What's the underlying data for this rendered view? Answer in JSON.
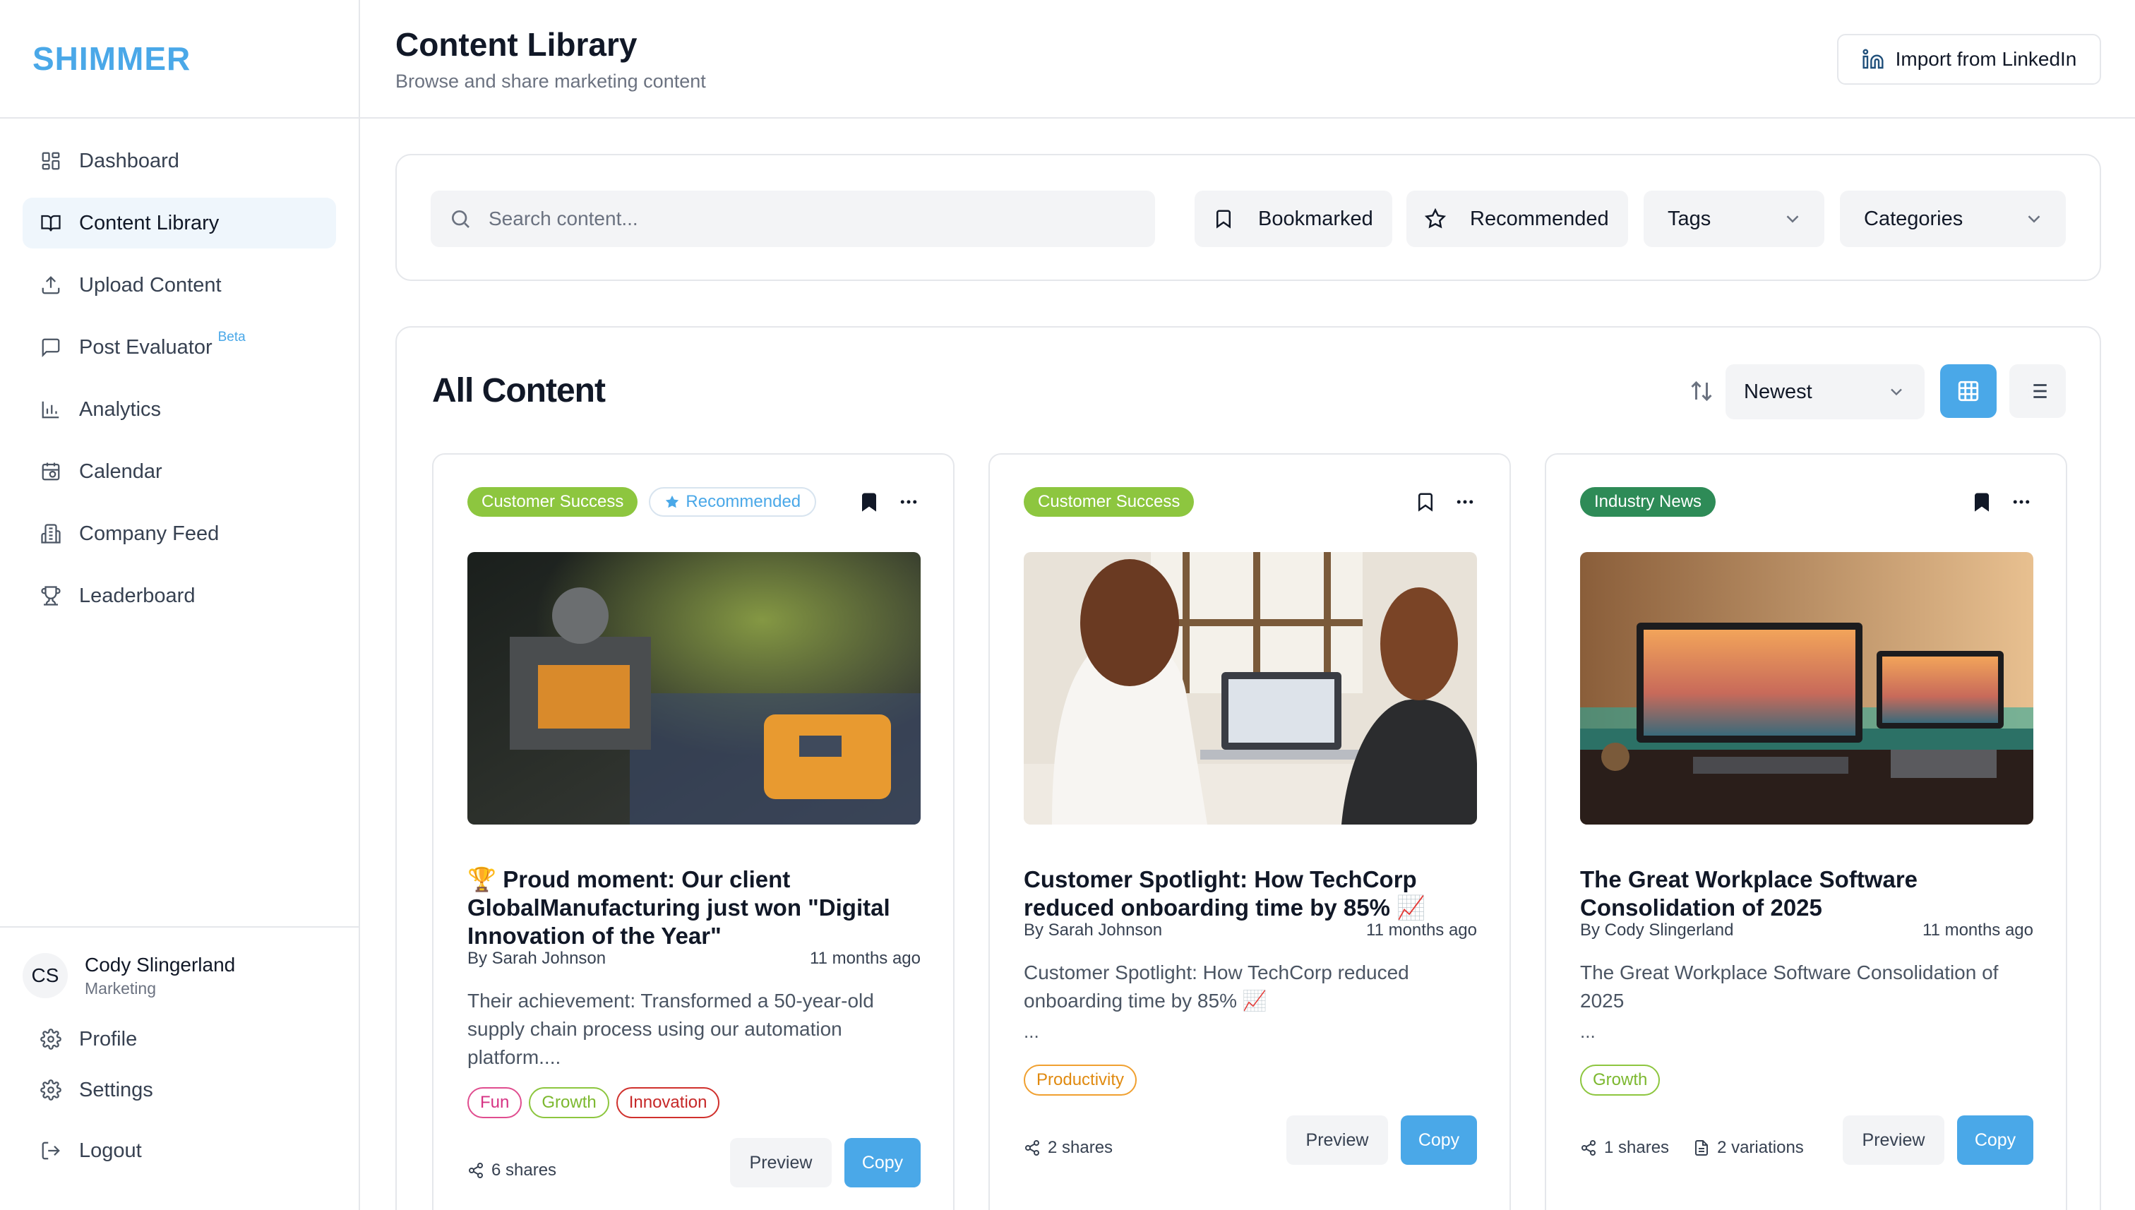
{
  "app": {
    "brand": "SHIMMER"
  },
  "sidebar": {
    "items": [
      {
        "label": "Dashboard",
        "icon": "grid-icon"
      },
      {
        "label": "Content Library",
        "icon": "book-icon",
        "active": true
      },
      {
        "label": "Upload Content",
        "icon": "upload-icon"
      },
      {
        "label": "Post Evaluator",
        "icon": "message-icon",
        "badge": "Beta"
      },
      {
        "label": "Analytics",
        "icon": "bar-chart-icon"
      },
      {
        "label": "Calendar",
        "icon": "calendar-icon"
      },
      {
        "label": "Company Feed",
        "icon": "building-icon"
      },
      {
        "label": "Leaderboard",
        "icon": "trophy-icon"
      }
    ],
    "user": {
      "initials": "CS",
      "name": "Cody Slingerland",
      "role": "Marketing"
    },
    "footer": {
      "profile": "Profile",
      "settings": "Settings",
      "logout": "Logout"
    }
  },
  "header": {
    "title": "Content Library",
    "subtitle": "Browse and share marketing content",
    "import_label": "Import from LinkedIn"
  },
  "filters": {
    "search_placeholder": "Search content...",
    "bookmarked": "Bookmarked",
    "recommended": "Recommended",
    "tags": "Tags",
    "categories": "Categories"
  },
  "content": {
    "title": "All Content",
    "sort_value": "Newest",
    "view_mode": "grid"
  },
  "cards": [
    {
      "category": "Customer Success",
      "recommended": "Recommended",
      "title": "🏆 Proud moment: Our client GlobalManufacturing just won \"Digital Innovation of the Year\"",
      "author": "By Sarah Johnson",
      "time": "11 months ago",
      "excerpt": "Their achievement: Transformed a 50-year-old supply chain process using our automation platform....",
      "tags": [
        "Fun",
        "Growth",
        "Innovation"
      ],
      "shares": "6 shares",
      "preview": "Preview",
      "copy": "Copy"
    },
    {
      "category": "Customer Success",
      "title": "Customer Spotlight: How TechCorp reduced onboarding time by 85% 📈",
      "author": "By Sarah Johnson",
      "time": "11 months ago",
      "excerpt": "Customer Spotlight: How TechCorp reduced onboarding time by 85% 📈",
      "ellipsis": "...",
      "tags": [
        "Productivity"
      ],
      "shares": "2 shares",
      "preview": "Preview",
      "copy": "Copy"
    },
    {
      "category": "Industry News",
      "title": "The Great Workplace Software Consolidation of 2025",
      "author": "By Cody Slingerland",
      "time": "11 months ago",
      "excerpt": "The Great Workplace Software Consolidation of 2025",
      "ellipsis": "...",
      "tags": [
        "Growth"
      ],
      "shares": "1 shares",
      "variations": "2 variations",
      "preview": "Preview",
      "copy": "Copy"
    }
  ],
  "colors": {
    "accent": "#4aa8e8",
    "tag_green": "#8dc63f",
    "tag_darkgreen": "#2e8b57",
    "tag_pink": "#d63384",
    "tag_red": "#c62828",
    "tag_orange": "#e08a10"
  }
}
